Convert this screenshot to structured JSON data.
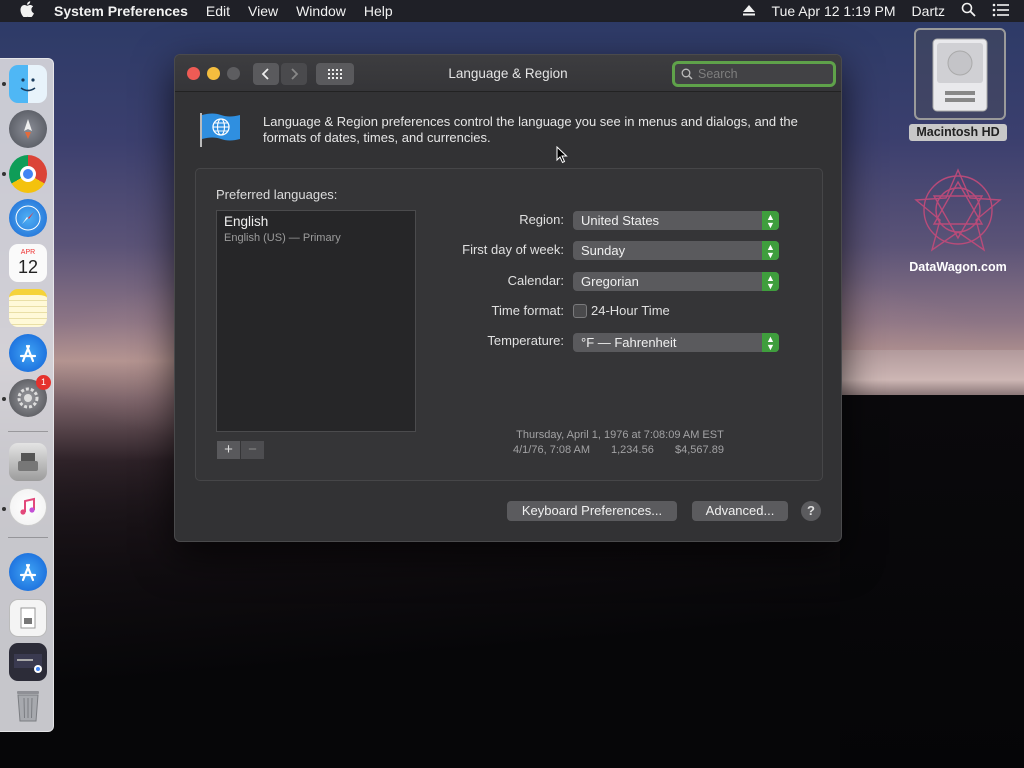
{
  "menubar": {
    "app_name": "System Preferences",
    "items": [
      "Edit",
      "View",
      "Window",
      "Help"
    ],
    "clock": "Tue Apr 12  1:19 PM",
    "user": "Dartz"
  },
  "desktop": {
    "hd_label": "Macintosh HD",
    "datawagon_label": "DataWagon.com"
  },
  "dock": {
    "calendar_month": "APR",
    "calendar_day": "12",
    "sysprefs_badge": "1"
  },
  "window": {
    "title": "Language & Region",
    "search_placeholder": "Search",
    "description": "Language & Region preferences control the language you see in menus and dialogs, and the formats of dates, times, and currencies.",
    "preferred_languages_label": "Preferred languages:",
    "languages": [
      {
        "name": "English",
        "detail": "English (US) — Primary"
      }
    ],
    "add_label": "+",
    "remove_label": "−",
    "form": {
      "region_label": "Region:",
      "region_value": "United States",
      "first_day_label": "First day of week:",
      "first_day_value": "Sunday",
      "calendar_label": "Calendar:",
      "calendar_value": "Gregorian",
      "time_format_label": "Time format:",
      "time_format_option": "24-Hour Time",
      "time_format_checked": false,
      "temperature_label": "Temperature:",
      "temperature_value": "°F — Fahrenheit"
    },
    "sample": {
      "datetime": "Thursday, April 1, 1976 at 7:08:09 AM EST",
      "short_date": "4/1/76, 7:08 AM",
      "number": "1,234.56",
      "currency": "$4,567.89"
    },
    "keyboard_button": "Keyboard Preferences...",
    "advanced_button": "Advanced...",
    "help_button": "?"
  },
  "colors": {
    "accent_green": "#3f9e3d",
    "search_focus": "#5fa24a",
    "close": "#ee5b55",
    "minimize": "#f4bd3e"
  }
}
